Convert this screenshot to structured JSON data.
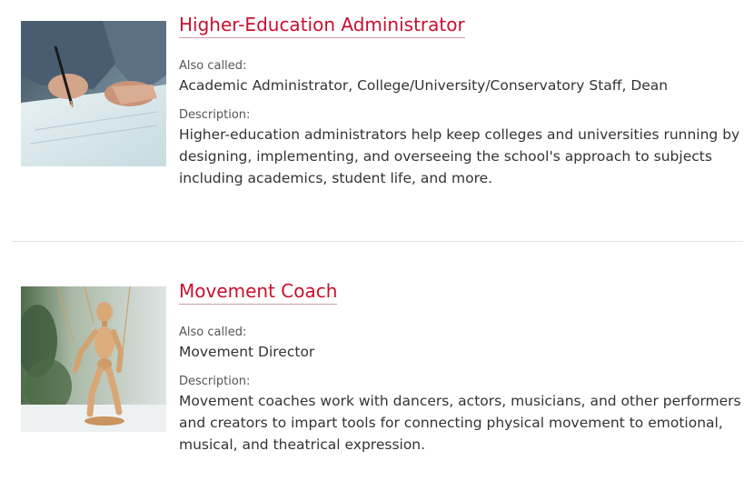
{
  "careers": [
    {
      "title": "Higher-Education Administrator",
      "also_called_label": "Also called:",
      "also_called": "Academic Administrator, College/University/Conservatory Staff, Dean",
      "description_label": "Description:",
      "description": "Higher-education administrators help keep colleges and universities running by designing, implementing, and overseeing the school's approach to subjects including academics, student life, and more."
    },
    {
      "title": "Movement Coach",
      "also_called_label": "Also called:",
      "also_called": "Movement Director",
      "description_label": "Description:",
      "description": "Movement coaches work with dancers, actors, musicians, and other performers and creators to impart tools for connecting physical movement to emotional, musical, and theatrical expression."
    }
  ],
  "colors": {
    "title_link": "#c8102e",
    "text": "#333333",
    "label": "#555555",
    "divider": "#e3e3e3"
  }
}
